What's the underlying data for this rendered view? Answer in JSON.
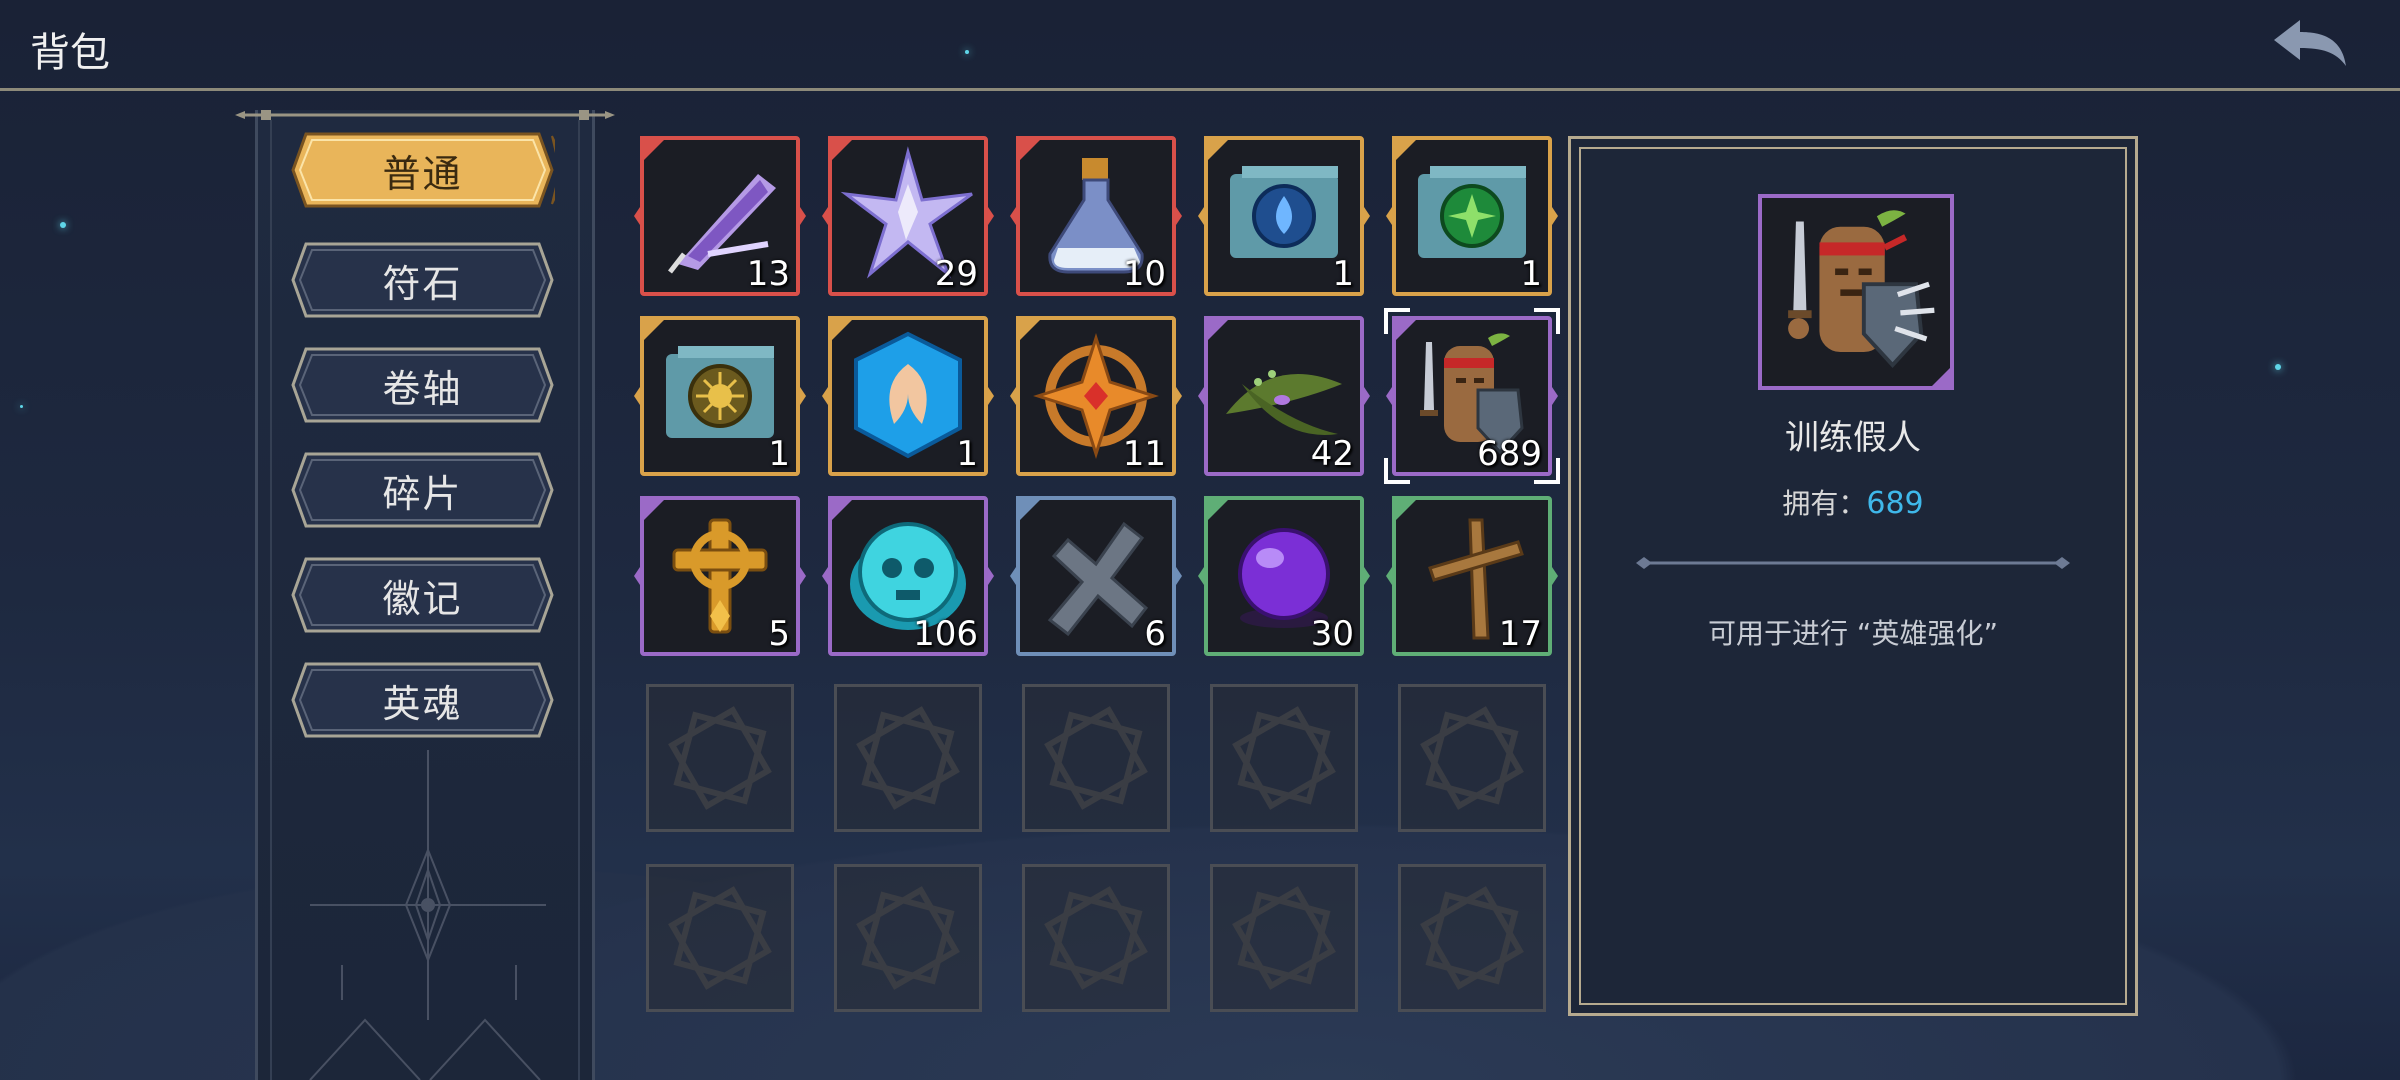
{
  "header": {
    "title": "背包",
    "back_icon": "back-arrow-icon"
  },
  "categories": [
    {
      "label": "普通",
      "active": true
    },
    {
      "label": "符石",
      "active": false
    },
    {
      "label": "卷轴",
      "active": false
    },
    {
      "label": "碎片",
      "active": false
    },
    {
      "label": "徽记",
      "active": false
    },
    {
      "label": "英魂",
      "active": false
    }
  ],
  "inventory": {
    "items": [
      {
        "icon": "purple-crystal-feather-icon",
        "count": "13",
        "rarity": "red"
      },
      {
        "icon": "star-crystal-icon",
        "count": "29",
        "rarity": "red"
      },
      {
        "icon": "potion-flask-icon",
        "count": "10",
        "rarity": "red"
      },
      {
        "icon": "water-rune-scroll-icon",
        "count": "1",
        "rarity": "orange"
      },
      {
        "icon": "nature-rune-scroll-icon",
        "count": "1",
        "rarity": "orange"
      },
      {
        "icon": "sun-rune-scroll-icon",
        "count": "1",
        "rarity": "orange"
      },
      {
        "icon": "blue-phoenix-emblem-icon",
        "count": "1",
        "rarity": "orange"
      },
      {
        "icon": "golden-cross-gem-icon",
        "count": "11",
        "rarity": "orange"
      },
      {
        "icon": "green-leaf-icon",
        "count": "42",
        "rarity": "purple"
      },
      {
        "icon": "training-dummy-icon",
        "count": "689",
        "rarity": "purple",
        "selected": true
      },
      {
        "icon": "golden-celtic-cross-icon",
        "count": "5",
        "rarity": "purple"
      },
      {
        "icon": "cyan-skull-token-icon",
        "count": "106",
        "rarity": "purple"
      },
      {
        "icon": "stone-cross-icon",
        "count": "6",
        "rarity": "blue"
      },
      {
        "icon": "purple-orb-icon",
        "count": "30",
        "rarity": "green"
      },
      {
        "icon": "wooden-cross-icon",
        "count": "17",
        "rarity": "green"
      }
    ],
    "empty_slots": 10
  },
  "detail": {
    "name": "训练假人",
    "owned_label": "拥有：",
    "owned_value": "689",
    "description": "可用于进行 “英雄强化”",
    "portrait_icon": "training-dummy-icon"
  },
  "colors": {
    "owned_value": "#3fb8ea",
    "active_tab": "#e9b55a",
    "rarity_red": "#d9504a",
    "rarity_orange": "#d9a24a",
    "rarity_purple": "#9b6ac7",
    "rarity_blue": "#6f8fb8",
    "rarity_green": "#5fae76"
  }
}
